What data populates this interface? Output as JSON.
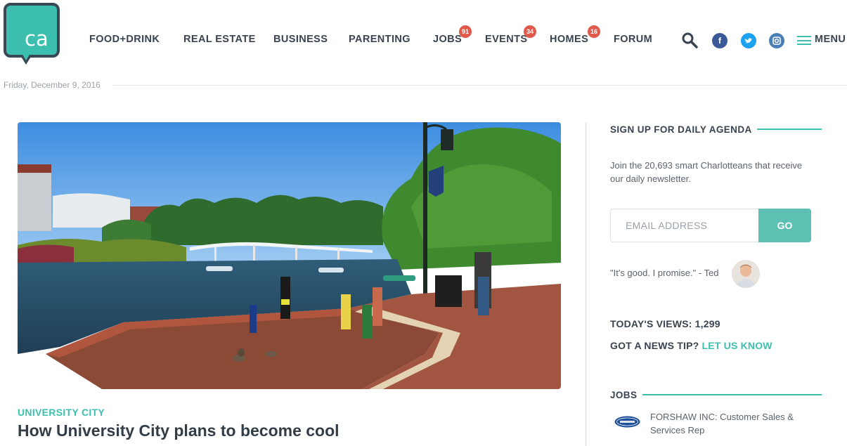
{
  "brand": {
    "logo_text": "ca",
    "accent_color": "#3cbfae"
  },
  "nav": {
    "items": [
      {
        "label": "FOOD+DRINK"
      },
      {
        "label": "REAL ESTATE"
      },
      {
        "label": "BUSINESS"
      },
      {
        "label": "PARENTING"
      },
      {
        "label": "JOBS",
        "badge": "91"
      },
      {
        "label": "EVENTS",
        "badge": "34"
      },
      {
        "label": "HOMES",
        "badge": "16"
      },
      {
        "label": "FORUM"
      }
    ],
    "menu_label": "MENU",
    "icons": [
      "search-icon",
      "facebook-icon",
      "twitter-icon",
      "instagram-icon",
      "hamburger-icon"
    ]
  },
  "date": "Friday, December 9, 2016",
  "article": {
    "kicker": "UNIVERSITY CITY",
    "headline": "How University City plans to become cool"
  },
  "sidebar": {
    "signup_heading": "SIGN UP FOR DAILY AGENDA",
    "signup_text": "Join the 20,693 smart Charlotteans that receive our daily newsletter.",
    "email_placeholder": "EMAIL ADDRESS",
    "go_label": "GO",
    "quote": "\"It's good. I promise.\" - Ted",
    "views": "TODAY'S VIEWS: 1,299",
    "tip_text": "GOT A NEWS TIP?",
    "tip_link": "LET US KNOW",
    "jobs_heading": "JOBS",
    "job_text": "FORSHAW INC: Customer Sales & Services Rep"
  }
}
